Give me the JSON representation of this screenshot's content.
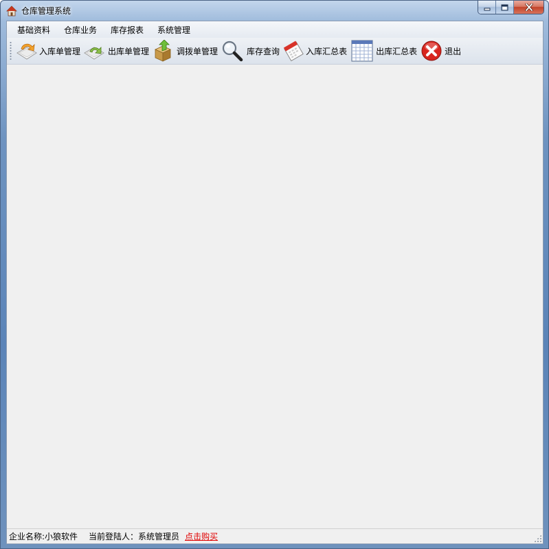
{
  "window": {
    "title": "仓库管理系统"
  },
  "menu": [
    {
      "label": "基础资料"
    },
    {
      "label": "仓库业务"
    },
    {
      "label": "库存报表"
    },
    {
      "label": "系统管理"
    }
  ],
  "toolbar": [
    {
      "label": "入库单管理",
      "icon": "inbound-doc-icon"
    },
    {
      "label": "出库单管理",
      "icon": "outbound-doc-icon"
    },
    {
      "label": "调拨单管理",
      "icon": "transfer-box-icon"
    },
    {
      "label": "库存查询",
      "icon": "magnifier-icon"
    },
    {
      "label": "入库汇总表",
      "icon": "calendar-icon"
    },
    {
      "label": "出库汇总表",
      "icon": "table-grid-icon"
    },
    {
      "label": "退出",
      "icon": "exit-icon"
    }
  ],
  "status": {
    "company": "企业名称:小狼软件",
    "current_user": "当前登陆人：系统管理员",
    "buy_link": "点击购买"
  },
  "colors": {
    "link": "#e00000",
    "close_button": "#c2432a"
  }
}
